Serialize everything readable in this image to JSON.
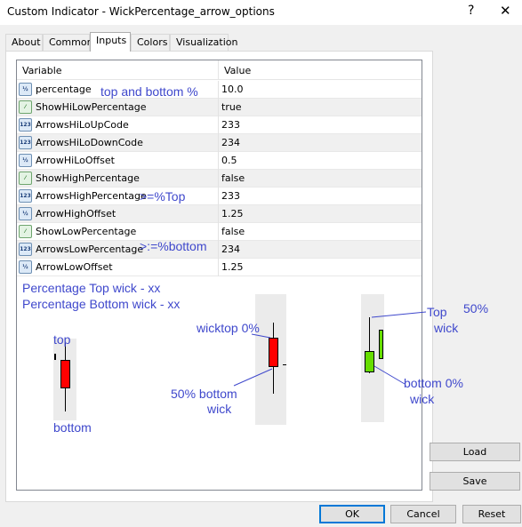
{
  "window": {
    "title": "Custom Indicator - WickPercentage_arrow_options",
    "help_glyph": "?",
    "close_glyph": "✕"
  },
  "tabs": [
    {
      "label": "About"
    },
    {
      "label": "Common"
    },
    {
      "label": "Inputs",
      "active": true
    },
    {
      "label": "Colors"
    },
    {
      "label": "Visualization"
    }
  ],
  "grid": {
    "col_variable": "Variable",
    "col_value": "Value",
    "rows": [
      {
        "icon": "double-type-icon",
        "icon_text": "½",
        "name": "percentage",
        "value": "10.0"
      },
      {
        "icon": "bool-type-icon",
        "icon_text": "⁄",
        "name": "ShowHiLowPercentage",
        "value": "true"
      },
      {
        "icon": "int-type-icon",
        "icon_text": "123",
        "name": "ArrowsHiLoUpCode",
        "value": "233"
      },
      {
        "icon": "int-type-icon",
        "icon_text": "123",
        "name": "ArrowsHiLoDownCode",
        "value": "234"
      },
      {
        "icon": "double-type-icon",
        "icon_text": "½",
        "name": "ArrowHiLoOffset",
        "value": "0.5"
      },
      {
        "icon": "bool-type-icon",
        "icon_text": "⁄",
        "name": "ShowHighPercentage",
        "value": "false"
      },
      {
        "icon": "int-type-icon",
        "icon_text": "123",
        "name": "ArrowsHighPercentage",
        "value": "233"
      },
      {
        "icon": "double-type-icon",
        "icon_text": "½",
        "name": "ArrowHighOffset",
        "value": "1.25"
      },
      {
        "icon": "bool-type-icon",
        "icon_text": "⁄",
        "name": "ShowLowPercentage",
        "value": "false"
      },
      {
        "icon": "int-type-icon",
        "icon_text": "123",
        "name": "ArrowsLowPercentage",
        "value": "234"
      },
      {
        "icon": "double-type-icon",
        "icon_text": "½",
        "name": "ArrowLowOffset",
        "value": "1.25"
      }
    ]
  },
  "annotations": {
    "top_and_bottom": "top and bottom %",
    "gte_top": ">=%Top",
    "lte_bottom": ">:=%bottom",
    "pct_top_wick": "Percentage Top wick - xx",
    "pct_bottom_wick": "Percentage Bottom wick - xx",
    "top": "top",
    "bottom": "bottom",
    "wicktop": "wicktop 0%",
    "fifty_bottom": "50%  bottom",
    "wick_1": "wick",
    "top_right": "Top",
    "fifty_right": "50%",
    "wick_2": "wick",
    "bottom_zero": "bottom 0%",
    "wick_3": "wick"
  },
  "buttons": {
    "load": "Load",
    "save": "Save",
    "ok": "OK",
    "cancel": "Cancel",
    "reset": "Reset"
  },
  "colors": {
    "annotation_blue": "#3f48cc",
    "bear_candle": "#ff0000",
    "bull_candle": "#66dd00",
    "focus_blue": "#0078d7"
  }
}
